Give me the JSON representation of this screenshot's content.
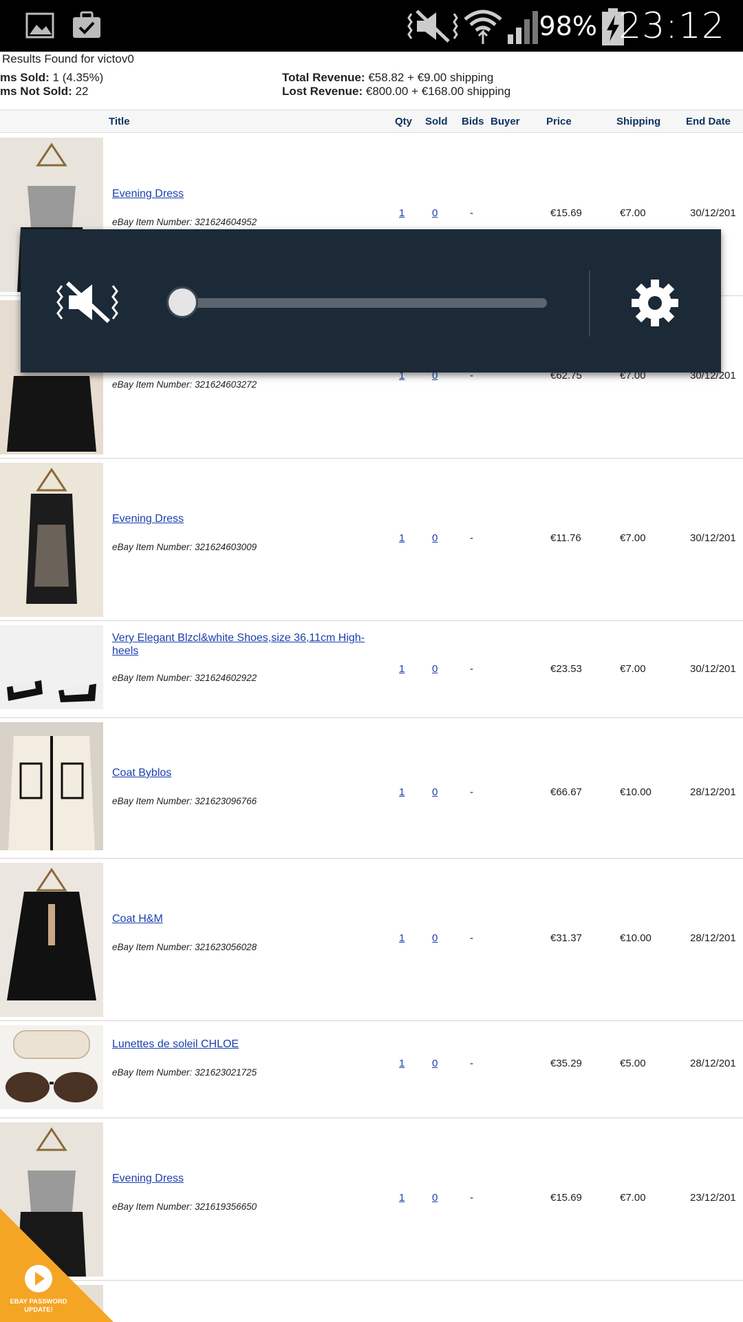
{
  "status_bar": {
    "battery_percent": "98%",
    "time": "23:12",
    "left_icons": [
      "gallery-icon",
      "task-check-icon"
    ],
    "right_icons": [
      "vibrate-mute-icon",
      "wifi-icon",
      "signal-icon",
      "battery-charging-icon"
    ]
  },
  "summary": {
    "results_label": "Results Found for victov0",
    "sold_label": "ms Sold:",
    "sold_value": "1 (4.35%)",
    "not_sold_label": "ms Not Sold:",
    "not_sold_value": "22",
    "total_revenue_label": "Total Revenue:",
    "total_revenue_value": "€58.82 + €9.00 shipping",
    "lost_revenue_label": "Lost Revenue:",
    "lost_revenue_value": "€800.00 + €168.00 shipping"
  },
  "table": {
    "columns": [
      "Title",
      "Qty",
      "Sold",
      "Bids",
      "Buyer",
      "Price",
      "Shipping",
      "End Date"
    ],
    "rows": [
      {
        "title": "Evening Dress",
        "item_number": "eBay Item Number: 321624604952",
        "qty": "1",
        "sold": "0",
        "bids": "-",
        "price": "€15.69",
        "shipping": "€7.00",
        "end_date": "30/12/201"
      },
      {
        "title": "",
        "item_number": "eBay Item Number: 321624603272",
        "qty": "1",
        "sold": "0",
        "bids": "-",
        "price": "€62.75",
        "shipping": "€7.00",
        "end_date": "30/12/201"
      },
      {
        "title": "Evening Dress",
        "item_number": "eBay Item Number: 321624603009",
        "qty": "1",
        "sold": "0",
        "bids": "-",
        "price": "€11.76",
        "shipping": "€7.00",
        "end_date": "30/12/201"
      },
      {
        "title": "Very Elegant Blzcl&white Shoes,size 36,11cm High-heels",
        "item_number": "eBay Item Number: 321624602922",
        "qty": "1",
        "sold": "0",
        "bids": "-",
        "price": "€23.53",
        "shipping": "€7.00",
        "end_date": "30/12/201"
      },
      {
        "title": "Coat Byblos",
        "item_number": "eBay Item Number: 321623096766",
        "qty": "1",
        "sold": "0",
        "bids": "-",
        "price": "€66.67",
        "shipping": "€10.00",
        "end_date": "28/12/201"
      },
      {
        "title": "Coat H&M",
        "item_number": "eBay Item Number: 321623056028",
        "qty": "1",
        "sold": "0",
        "bids": "-",
        "price": "€31.37",
        "shipping": "€10.00",
        "end_date": "28/12/201"
      },
      {
        "title": "Lunettes de soleil CHLOE",
        "item_number": "eBay Item Number: 321623021725",
        "qty": "1",
        "sold": "0",
        "bids": "-",
        "price": "€35.29",
        "shipping": "€5.00",
        "end_date": "28/12/201"
      },
      {
        "title": "Evening Dress",
        "item_number": "eBay Item Number: 321619356650",
        "qty": "1",
        "sold": "0",
        "bids": "-",
        "price": "€15.69",
        "shipping": "€7.00",
        "end_date": "23/12/201"
      }
    ]
  },
  "volume_overlay": {
    "mode_icon": "vibrate-mute-icon",
    "level": 0,
    "settings_icon": "gear-icon"
  },
  "promo": {
    "text_line1": "EBAY PASSWORD",
    "text_line2": "UPDATE!",
    "icon": "play-icon",
    "color": "#f5a524"
  }
}
